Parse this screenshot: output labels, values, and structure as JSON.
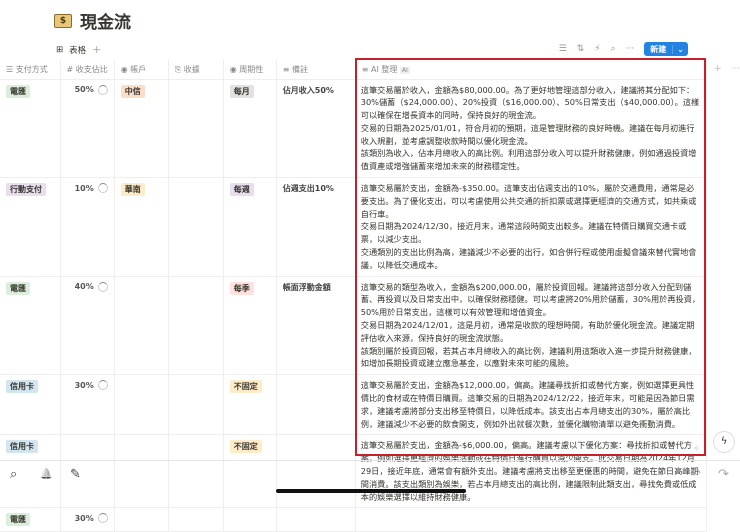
{
  "page": {
    "title": "現金流",
    "emoji": "$"
  },
  "view": {
    "label": "表格",
    "add": "+"
  },
  "toolbar": {
    "new_label": "新建",
    "filter": "☰",
    "sort": "⇅",
    "automation": "⚡",
    "search": "⌕",
    "more": "···",
    "dropdown": "⌄"
  },
  "columns": [
    {
      "icon": "☰",
      "label": "支付方式"
    },
    {
      "icon": "#",
      "label": "收支佔比"
    },
    {
      "icon": "◉",
      "label": "帳戶"
    },
    {
      "icon": "⎘",
      "label": "收據"
    },
    {
      "icon": "◉",
      "label": "周期性"
    },
    {
      "icon": "≡",
      "label": "備註"
    },
    {
      "icon": "≡",
      "label": "AI 整理",
      "badge": "AI"
    }
  ],
  "rows": [
    {
      "payment": "電匯",
      "payment_color": "#dbeddb",
      "ratio": "50%",
      "account": "中信",
      "account_color": "#fadec9",
      "period": "每月",
      "period_color": "#e3e2e0",
      "note": "佔月收入50%",
      "ai": "這筆交易屬於收入，金額為$80,000.00。為了更好地管理這部分收入，建議將其分配如下：30%儲蓄（$24,000.00）、20%投資（$16,000.00）、50%日常支出（$40,000.00）。這樣可以確保在增長資本的同時，保持良好的現金流。\n交易的日期為2025/01/01，符合月初的預期，這是管理財務的良好時機。建議在每月初進行收入規劃，並考慮調整收款時間以優化現金流。\n該類別為收入，佔本月總收入的高比例。利用這部分收入可以提升財務健康，例如通過投資增值資產或增強儲蓄來增加未來的財務穩定性。"
    },
    {
      "payment": "行動支付",
      "payment_color": "#e8deee",
      "ratio": "10%",
      "account": "華南",
      "account_color": "#fdecc8",
      "period": "每週",
      "period_color": "#e8deee",
      "note": "佔週支出10%",
      "ai": "這筆交易屬於支出，金額為-$350.00。這筆支出佔週支出的10%，屬於交通費用，通常是必要支出。為了優化支出，可以考慮使用公共交通的折扣票或選擇更經濟的交通方式，如共乘或自行車。\n交易日期為2024/12/30，接近月末，通常這段時間支出較多。建議在特價日購買交通卡或票，以減少支出。\n交通類別的支出比例為高，建議減少不必要的出行，如合併行程或使用虛擬會議來替代實地會議，以降低交通成本。"
    },
    {
      "payment": "電匯",
      "payment_color": "#dbeddb",
      "ratio": "40%",
      "account": "",
      "account_color": "",
      "period": "每季",
      "period_color": "#ffe2dd",
      "note": "帳面浮動金額",
      "ai": "這筆交易的類型為收入，金額為$200,000.00，屬於投資回報。建議將這部分收入分配到儲蓄、再投資以及日常支出中，以確保財務穩健。可以考慮將20%用於儲蓄，30%用於再投資，50%用於日常支出，這樣可以有效管理和增值資金。\n交易日期為2024/12/01，這是月初，通常是收款的理想時間，有助於優化現金流。建議定期評估收入來源，保持良好的現金流狀態。\n該類別屬於投資回報，若其占本月總收入的高比例，建議利用這類收入進一步提升財務健康，如增加長期投資或建立應急基金，以應對未來可能的風險。"
    },
    {
      "payment": "信用卡",
      "payment_color": "#d3e5ef",
      "ratio": "30%",
      "account": "",
      "account_color": "",
      "period": "不固定",
      "period_color": "#fdecc8",
      "note": "",
      "ai": "這筆交易屬於支出，金額為$12,000.00，偏高。建議尋找折扣或替代方案，例如選擇更具性價比的食材或在特價日購買。這筆交易的日期為2024/12/22，接近年末，可能是因為節日需求，建議考慮將部分支出移至特價日，以降低成本。該支出占本月總支出的30%，屬於高比例，建議減少不必要的飲食開支，例如外出就餐次數，並優化購物清單以避免衝動消費。"
    },
    {
      "payment": "信用卡",
      "payment_color": "#d3e5ef",
      "ratio": "",
      "account": "",
      "account_color": "",
      "period": "不固定",
      "period_color": "#fdecc8",
      "note": "",
      "ai": "這筆交易屬於支出，金額為-$6,000.00，偏高。建議考慮以下優化方案：尋找折扣或替代方案，例如選擇更經濟的娛樂活動或在特價日進行購買以減少開支。此交易日期為2024年12月29日，接近年底，通常會有額外支出。建議考慮將支出移至更優惠的時間，避免在節日高峰期間消費。該支出類別為娛樂，若占本月總支出的高比例，建議限制此類支出，尋找免費或低成本的娛樂選擇以維持財務健康。"
    },
    {
      "payment": "電匯",
      "payment_color": "#dbeddb",
      "ratio": "30%",
      "account": "",
      "account_color": "",
      "period": "",
      "period_color": "",
      "note": "",
      "ai": ""
    }
  ],
  "ratio_fractions": [
    0.5,
    0.1,
    0.4,
    0.3,
    null,
    0.3
  ],
  "bottom": {
    "search": "⌕",
    "bell": "🔔",
    "compose": "✎",
    "undo": "↶",
    "redo": "↷"
  },
  "colors": {
    "accent": "#2383e2",
    "highlight": "#c8202a"
  }
}
